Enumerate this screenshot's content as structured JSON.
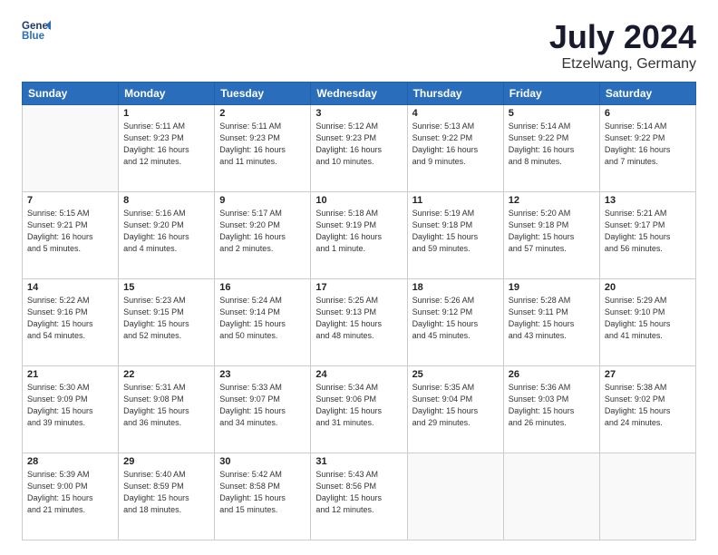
{
  "header": {
    "logo_line1": "General",
    "logo_line2": "Blue",
    "month_year": "July 2024",
    "location": "Etzelwang, Germany"
  },
  "weekdays": [
    "Sunday",
    "Monday",
    "Tuesday",
    "Wednesday",
    "Thursday",
    "Friday",
    "Saturday"
  ],
  "weeks": [
    [
      {
        "date": "",
        "info": ""
      },
      {
        "date": "1",
        "info": "Sunrise: 5:11 AM\nSunset: 9:23 PM\nDaylight: 16 hours\nand 12 minutes."
      },
      {
        "date": "2",
        "info": "Sunrise: 5:11 AM\nSunset: 9:23 PM\nDaylight: 16 hours\nand 11 minutes."
      },
      {
        "date": "3",
        "info": "Sunrise: 5:12 AM\nSunset: 9:23 PM\nDaylight: 16 hours\nand 10 minutes."
      },
      {
        "date": "4",
        "info": "Sunrise: 5:13 AM\nSunset: 9:22 PM\nDaylight: 16 hours\nand 9 minutes."
      },
      {
        "date": "5",
        "info": "Sunrise: 5:14 AM\nSunset: 9:22 PM\nDaylight: 16 hours\nand 8 minutes."
      },
      {
        "date": "6",
        "info": "Sunrise: 5:14 AM\nSunset: 9:22 PM\nDaylight: 16 hours\nand 7 minutes."
      }
    ],
    [
      {
        "date": "7",
        "info": "Sunrise: 5:15 AM\nSunset: 9:21 PM\nDaylight: 16 hours\nand 5 minutes."
      },
      {
        "date": "8",
        "info": "Sunrise: 5:16 AM\nSunset: 9:20 PM\nDaylight: 16 hours\nand 4 minutes."
      },
      {
        "date": "9",
        "info": "Sunrise: 5:17 AM\nSunset: 9:20 PM\nDaylight: 16 hours\nand 2 minutes."
      },
      {
        "date": "10",
        "info": "Sunrise: 5:18 AM\nSunset: 9:19 PM\nDaylight: 16 hours\nand 1 minute."
      },
      {
        "date": "11",
        "info": "Sunrise: 5:19 AM\nSunset: 9:18 PM\nDaylight: 15 hours\nand 59 minutes."
      },
      {
        "date": "12",
        "info": "Sunrise: 5:20 AM\nSunset: 9:18 PM\nDaylight: 15 hours\nand 57 minutes."
      },
      {
        "date": "13",
        "info": "Sunrise: 5:21 AM\nSunset: 9:17 PM\nDaylight: 15 hours\nand 56 minutes."
      }
    ],
    [
      {
        "date": "14",
        "info": "Sunrise: 5:22 AM\nSunset: 9:16 PM\nDaylight: 15 hours\nand 54 minutes."
      },
      {
        "date": "15",
        "info": "Sunrise: 5:23 AM\nSunset: 9:15 PM\nDaylight: 15 hours\nand 52 minutes."
      },
      {
        "date": "16",
        "info": "Sunrise: 5:24 AM\nSunset: 9:14 PM\nDaylight: 15 hours\nand 50 minutes."
      },
      {
        "date": "17",
        "info": "Sunrise: 5:25 AM\nSunset: 9:13 PM\nDaylight: 15 hours\nand 48 minutes."
      },
      {
        "date": "18",
        "info": "Sunrise: 5:26 AM\nSunset: 9:12 PM\nDaylight: 15 hours\nand 45 minutes."
      },
      {
        "date": "19",
        "info": "Sunrise: 5:28 AM\nSunset: 9:11 PM\nDaylight: 15 hours\nand 43 minutes."
      },
      {
        "date": "20",
        "info": "Sunrise: 5:29 AM\nSunset: 9:10 PM\nDaylight: 15 hours\nand 41 minutes."
      }
    ],
    [
      {
        "date": "21",
        "info": "Sunrise: 5:30 AM\nSunset: 9:09 PM\nDaylight: 15 hours\nand 39 minutes."
      },
      {
        "date": "22",
        "info": "Sunrise: 5:31 AM\nSunset: 9:08 PM\nDaylight: 15 hours\nand 36 minutes."
      },
      {
        "date": "23",
        "info": "Sunrise: 5:33 AM\nSunset: 9:07 PM\nDaylight: 15 hours\nand 34 minutes."
      },
      {
        "date": "24",
        "info": "Sunrise: 5:34 AM\nSunset: 9:06 PM\nDaylight: 15 hours\nand 31 minutes."
      },
      {
        "date": "25",
        "info": "Sunrise: 5:35 AM\nSunset: 9:04 PM\nDaylight: 15 hours\nand 29 minutes."
      },
      {
        "date": "26",
        "info": "Sunrise: 5:36 AM\nSunset: 9:03 PM\nDaylight: 15 hours\nand 26 minutes."
      },
      {
        "date": "27",
        "info": "Sunrise: 5:38 AM\nSunset: 9:02 PM\nDaylight: 15 hours\nand 24 minutes."
      }
    ],
    [
      {
        "date": "28",
        "info": "Sunrise: 5:39 AM\nSunset: 9:00 PM\nDaylight: 15 hours\nand 21 minutes."
      },
      {
        "date": "29",
        "info": "Sunrise: 5:40 AM\nSunset: 8:59 PM\nDaylight: 15 hours\nand 18 minutes."
      },
      {
        "date": "30",
        "info": "Sunrise: 5:42 AM\nSunset: 8:58 PM\nDaylight: 15 hours\nand 15 minutes."
      },
      {
        "date": "31",
        "info": "Sunrise: 5:43 AM\nSunset: 8:56 PM\nDaylight: 15 hours\nand 12 minutes."
      },
      {
        "date": "",
        "info": ""
      },
      {
        "date": "",
        "info": ""
      },
      {
        "date": "",
        "info": ""
      }
    ]
  ]
}
